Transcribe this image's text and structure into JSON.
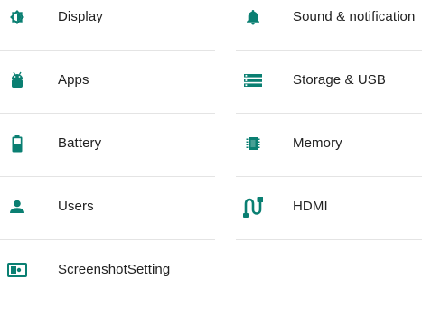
{
  "accent_color": "#0a7f72",
  "left_items": [
    {
      "label": "Display",
      "icon": "brightness-icon"
    },
    {
      "label": "Apps",
      "icon": "android-icon"
    },
    {
      "label": "Battery",
      "icon": "battery-icon"
    },
    {
      "label": "Users",
      "icon": "person-icon"
    },
    {
      "label": "ScreenshotSetting",
      "icon": "screenshot-icon"
    }
  ],
  "right_items": [
    {
      "label": "Sound & notification",
      "icon": "bell-icon"
    },
    {
      "label": "Storage & USB",
      "icon": "storage-icon"
    },
    {
      "label": "Memory",
      "icon": "memory-chip-icon"
    },
    {
      "label": "HDMI",
      "icon": "hdmi-icon"
    }
  ]
}
